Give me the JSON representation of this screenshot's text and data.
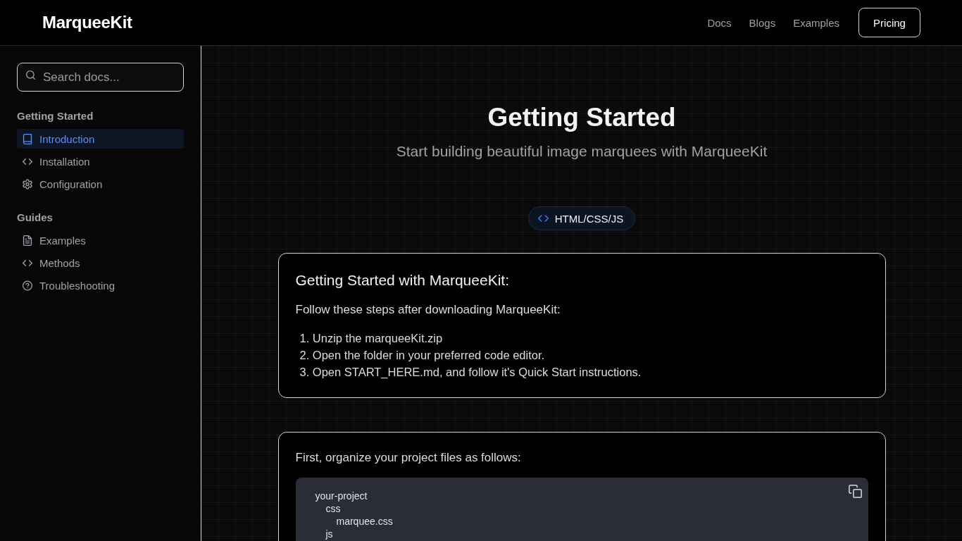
{
  "header": {
    "logo": "MarqueeKit",
    "nav": [
      {
        "label": "Docs"
      },
      {
        "label": "Blogs"
      },
      {
        "label": "Examples"
      }
    ],
    "button": "Pricing"
  },
  "sidebar": {
    "search": {
      "placeholder": "Search docs..."
    },
    "sections": [
      {
        "title": "Getting Started",
        "items": [
          {
            "label": "Introduction",
            "selected": true
          },
          {
            "label": "Installation",
            "selected": false
          },
          {
            "label": "Configuration",
            "selected": false
          }
        ]
      },
      {
        "title": "Guides",
        "items": [
          {
            "label": "Examples",
            "selected": false
          },
          {
            "label": "Methods",
            "selected": false
          },
          {
            "label": "Troubleshooting",
            "selected": false
          }
        ]
      }
    ]
  },
  "main": {
    "title": "Getting Started",
    "subtitle": "Start building beautiful image marquees with MarqueeKit",
    "badge": "HTML/CSS/JS",
    "cards": [
      {
        "kind": "steps",
        "title": "Getting Started with MarqueeKit:",
        "intro": "Follow these steps after downloading MarqueeKit:",
        "steps": [
          "1. Unzip the marqueeKit.zip",
          "2. Open the folder in your preferred code editor.",
          "3. Open START_HERE.md, and follow it's Quick Start instructions."
        ]
      },
      {
        "kind": "code",
        "intro": "First, organize your project files as follows:",
        "tree": [
          {
            "name": "your-project",
            "children": [
              {
                "name": "css",
                "children": [
                  {
                    "name": "marquee.css"
                  }
                ]
              },
              {
                "name": "js"
              }
            ]
          }
        ]
      }
    ]
  }
}
